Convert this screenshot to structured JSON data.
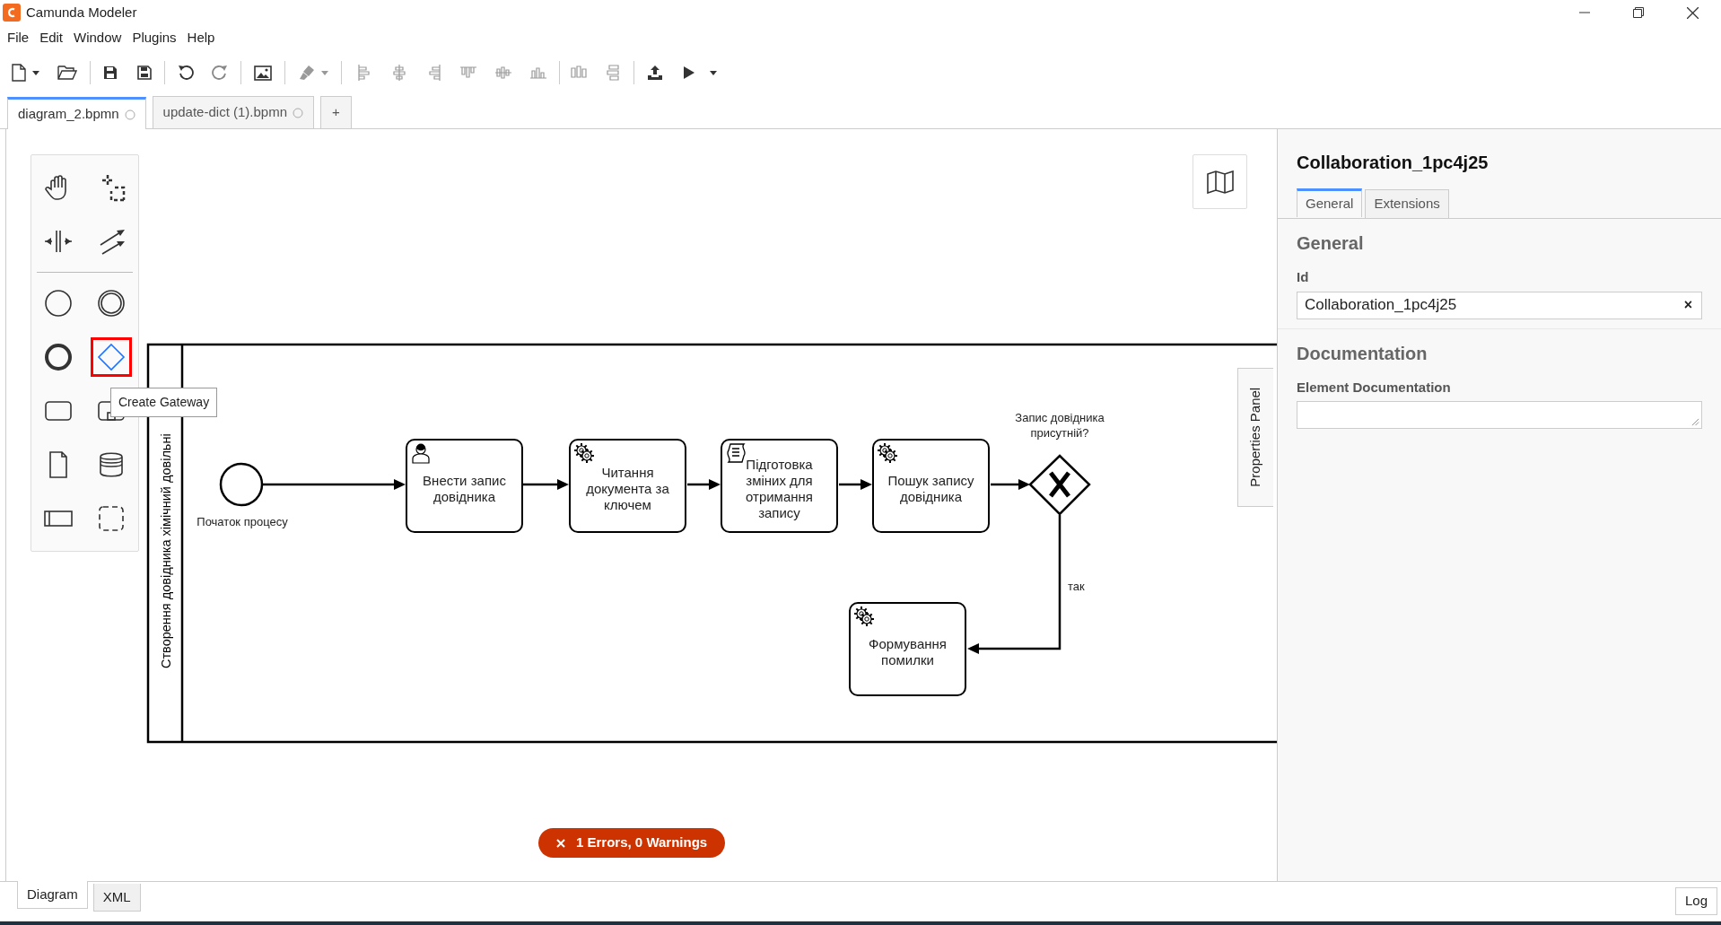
{
  "window": {
    "title": "Camunda Modeler"
  },
  "menu": [
    "File",
    "Edit",
    "Window",
    "Plugins",
    "Help"
  ],
  "file_tabs": [
    {
      "label": "diagram_2.bpmn",
      "selected": true,
      "closable": true
    },
    {
      "label": "update-dict (1).bpmn",
      "selected": false,
      "closable": true
    },
    {
      "label": "+",
      "selected": false,
      "closable": false
    }
  ],
  "palette": {
    "tools": [
      {
        "kind": "hand",
        "highlighted": false
      },
      {
        "kind": "lasso",
        "highlighted": false
      },
      {
        "kind": "space",
        "highlighted": false
      },
      {
        "kind": "connect",
        "highlighted": false
      },
      {
        "kind": "start",
        "highlighted": false
      },
      {
        "kind": "intermediate",
        "highlighted": false
      },
      {
        "kind": "end",
        "highlighted": false
      },
      {
        "kind": "gateway",
        "highlighted": true
      },
      {
        "kind": "task",
        "highlighted": false
      },
      {
        "kind": "subprocess",
        "highlighted": false
      },
      {
        "kind": "data-object",
        "highlighted": false
      },
      {
        "kind": "data-store",
        "highlighted": false
      },
      {
        "kind": "pool",
        "highlighted": false
      },
      {
        "kind": "group",
        "highlighted": false
      }
    ],
    "tooltip": "Create Gateway"
  },
  "diagram": {
    "lane_label": "Створення довідника хімічний довільні",
    "start_event": {
      "label": "Початок процесу"
    },
    "tasks": [
      {
        "kind": "user",
        "label": "Внести запис довідника"
      },
      {
        "kind": "service",
        "label": "Читання документа за ключем"
      },
      {
        "kind": "script",
        "label": "Підготовка зміних для отримання запису"
      },
      {
        "kind": "service",
        "label": "Пошук запису довідника"
      },
      {
        "kind": "service",
        "label": "Формування помилки"
      }
    ],
    "gateway": {
      "label": "Запис довідника присутній?"
    },
    "flow_label": "так"
  },
  "side_tab": "Properties Panel",
  "properties": {
    "title": "Collaboration_1pc4j25",
    "tabs": [
      {
        "label": "General",
        "selected": true
      },
      {
        "label": "Extensions",
        "selected": false
      }
    ],
    "sections": [
      {
        "heading": "General",
        "field": {
          "kind": "text",
          "label": "Id",
          "value": "Collaboration_1pc4j25",
          "clear": "×"
        }
      },
      {
        "heading": "Documentation",
        "field": {
          "kind": "textarea",
          "label": "Element Documentation"
        }
      }
    ]
  },
  "lint": {
    "text": "1 Errors, 0 Warnings"
  },
  "view_tabs": [
    {
      "label": "Diagram",
      "selected": true
    },
    {
      "label": "XML",
      "selected": false
    }
  ],
  "log_button": "Log"
}
